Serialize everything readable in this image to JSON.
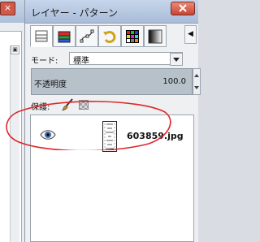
{
  "left_window": {
    "close_glyph": "×",
    "scroll_glyph": "▣"
  },
  "dock": {
    "title": "レイヤー - パターン",
    "tabs": [
      {
        "icon": "layers-stack-icon"
      },
      {
        "icon": "channels-icon"
      },
      {
        "icon": "paths-icon"
      },
      {
        "icon": "undo-history-icon"
      },
      {
        "icon": "color-palette-icon"
      },
      {
        "icon": "gradient-icon"
      }
    ],
    "tab_menu_glyph": "◀",
    "mode": {
      "label": "モード:",
      "value": "標準"
    },
    "opacity": {
      "label": "不透明度",
      "value": "100.0"
    },
    "lock": {
      "label": "保護:"
    },
    "layers": [
      {
        "name": "603859.jpg",
        "visible": true
      }
    ],
    "highlight_color": "#e0262a"
  }
}
